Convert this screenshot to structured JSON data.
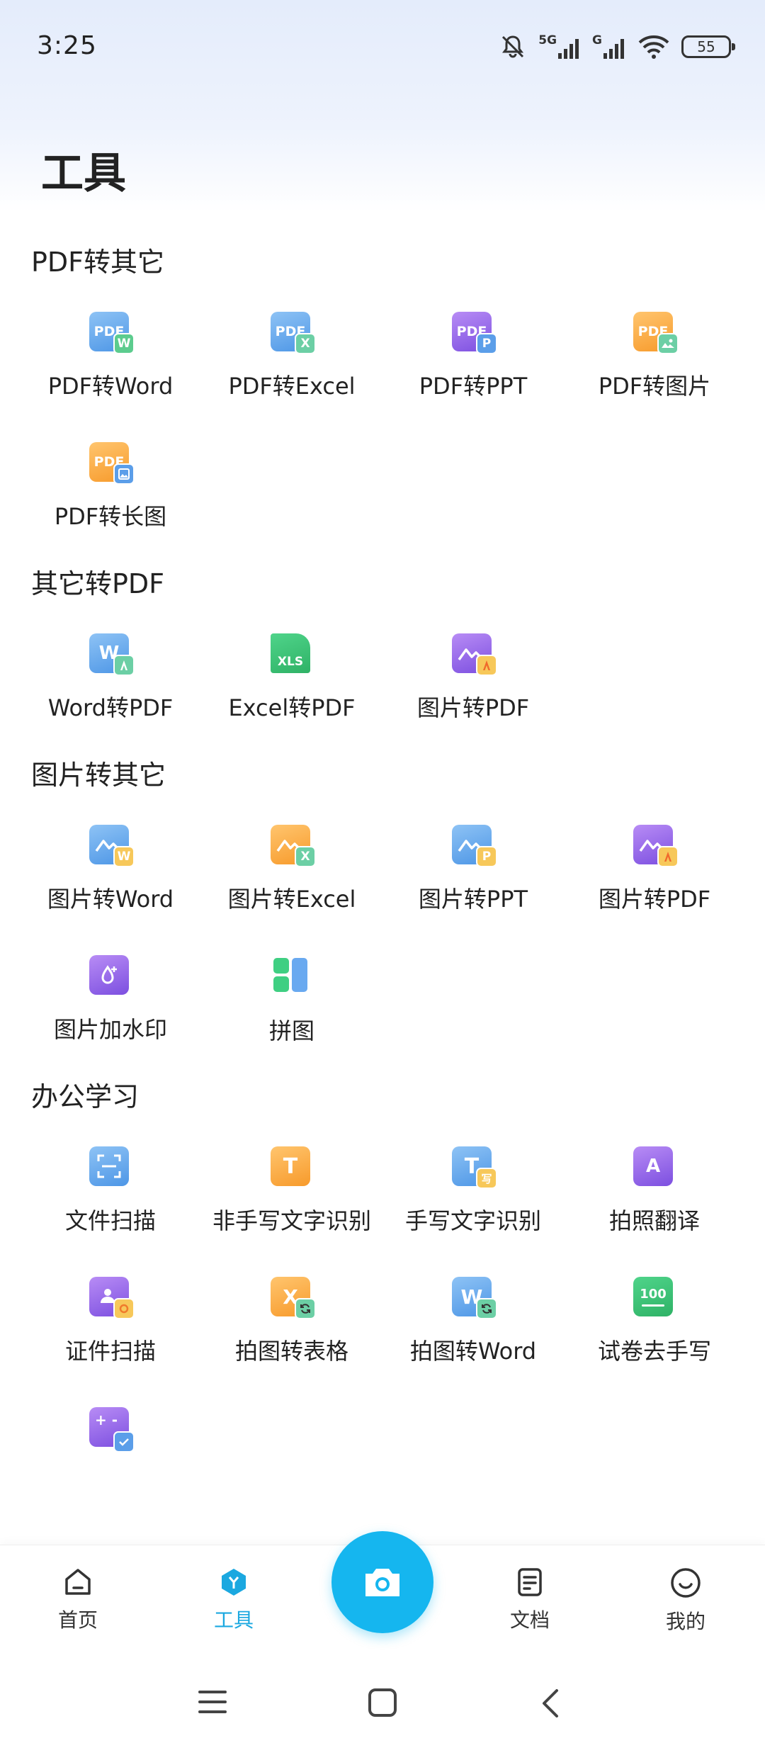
{
  "status_bar": {
    "time": "3:25",
    "network_1": "5G",
    "network_2": "G",
    "battery": "55"
  },
  "page": {
    "title": "工具"
  },
  "sections": [
    {
      "title": "PDF转其它",
      "tools": [
        {
          "label": "PDF转Word",
          "icon_text": "PDF",
          "badge_text": "W"
        },
        {
          "label": "PDF转Excel",
          "icon_text": "PDF",
          "badge_text": "X"
        },
        {
          "label": "PDF转PPT",
          "icon_text": "PDF",
          "badge_text": "P"
        },
        {
          "label": "PDF转图片",
          "icon_text": "PDF"
        },
        {
          "label": "PDF转长图",
          "icon_text": "PDF"
        }
      ]
    },
    {
      "title": "其它转PDF",
      "tools": [
        {
          "label": "Word转PDF",
          "icon_text": "W"
        },
        {
          "label": "Excel转PDF",
          "icon_text": "XLS"
        },
        {
          "label": "图片转PDF"
        }
      ]
    },
    {
      "title": "图片转其它",
      "tools": [
        {
          "label": "图片转Word",
          "badge_text": "W"
        },
        {
          "label": "图片转Excel",
          "badge_text": "X"
        },
        {
          "label": "图片转PPT",
          "badge_text": "P"
        },
        {
          "label": "图片转PDF"
        },
        {
          "label": "图片加水印"
        },
        {
          "label": "拼图"
        }
      ]
    },
    {
      "title": "办公学习",
      "tools": [
        {
          "label": "文件扫描"
        },
        {
          "label": "非手写文字识别",
          "icon_text": "T"
        },
        {
          "label": "手写文字识别",
          "icon_text": "T",
          "badge_text": "写"
        },
        {
          "label": "拍照翻译",
          "icon_text": "A"
        },
        {
          "label": "证件扫描"
        },
        {
          "label": "拍图转表格",
          "icon_text": "X"
        },
        {
          "label": "拍图转Word",
          "icon_text": "W"
        },
        {
          "label": "试卷去手写",
          "icon_text": "100"
        },
        {
          "icon_text": "+ -"
        }
      ]
    }
  ],
  "bottom_nav": {
    "home": "首页",
    "tools": "工具",
    "docs": "文档",
    "mine": "我的"
  },
  "colors": {
    "accent": "#1ba8e0",
    "camera": "#15b6ef"
  }
}
